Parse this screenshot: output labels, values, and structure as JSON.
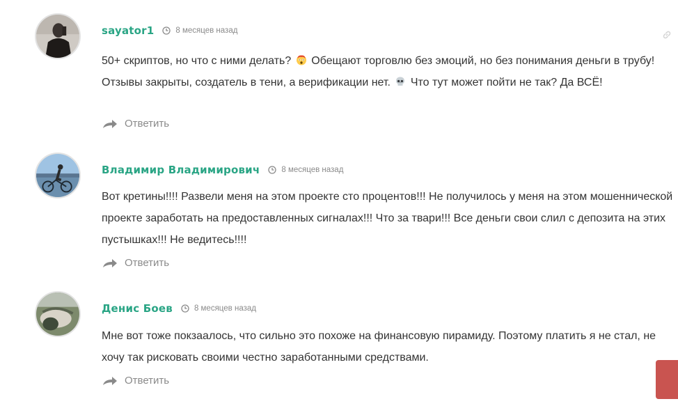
{
  "comments": [
    {
      "author": "sayator1",
      "time": "8 месяцев назад",
      "text_parts": [
        "50+ скриптов, но что с ними делать?",
        "Обещают торговлю без эмоций, но без понимания деньги в трубу! Отзывы закрыты, создатель в тени, а верификации нет.",
        "Что тут может пойти не так? Да ВСЁ!"
      ],
      "emojis": [
        "shocked-face-icon",
        "skull-icon"
      ],
      "reply_label": "Ответить",
      "avatar": "avatar-dark-photo"
    },
    {
      "author": "Владимир Владимирович",
      "time": "8 месяцев назад",
      "text": "Вот кретины!!!! Развели меня на этом проекте сто процентов!!! Не получилось у меня на этом мошеннической проекте заработать на предоставленных сигналах!!! Что за твари!!! Все деньги свои слил с депозита на этих пустышках!!! Не ведитесь!!!!",
      "reply_label": "Ответить",
      "avatar": "avatar-cyclist-photo"
    },
    {
      "author": "Денис Боев",
      "time": "8 месяцев назад",
      "text": "Мне вот тоже покзаалось, что сильно это похоже на финансовую пирамиду. Поэтому платить я не стал, не хочу так рисковать своими честно заработанными средствами.",
      "reply_label": "Ответить",
      "avatar": "avatar-outdoor-photo"
    }
  ],
  "colors": {
    "author": "#2aa585",
    "text": "#333333",
    "muted": "#8a8a8a",
    "float_button": "#c95450"
  },
  "icons": {
    "clock": "clock-icon",
    "reply": "reply-arrow-icon",
    "permalink": "link-icon"
  }
}
